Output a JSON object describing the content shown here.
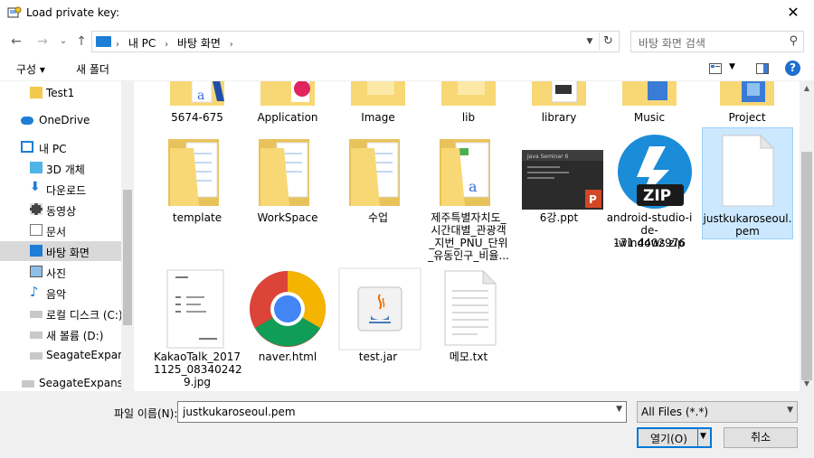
{
  "window": {
    "title": "Load private key:",
    "close_glyph": "✕"
  },
  "nav": {
    "back_glyph": "←",
    "forward_glyph": "→",
    "recent_glyph": "⌄",
    "up_glyph": "↑",
    "breadcrumb": [
      "내 PC",
      "바탕 화면"
    ],
    "crumb_separator": "›",
    "search_placeholder": "바탕 화면 검색"
  },
  "toolbar": {
    "organize_label": "구성 ▾",
    "new_folder_label": "새 폴더",
    "help_label": "?"
  },
  "sidebar": {
    "items": [
      {
        "label": "Test1",
        "icon": "folder-icon"
      },
      {
        "label": "OneDrive",
        "icon": "cloud-icon"
      },
      {
        "label": "내 PC",
        "icon": "computer-icon"
      },
      {
        "label": "3D 개체",
        "icon": "cube-icon"
      },
      {
        "label": "다운로드",
        "icon": "download-icon"
      },
      {
        "label": "동영상",
        "icon": "film-icon"
      },
      {
        "label": "문서",
        "icon": "document-icon"
      },
      {
        "label": "바탕 화면",
        "icon": "desktop-icon",
        "selected": true
      },
      {
        "label": "사진",
        "icon": "picture-icon"
      },
      {
        "label": "음악",
        "icon": "music-icon"
      },
      {
        "label": "로컬 디스크 (C:)",
        "icon": "drive-icon"
      },
      {
        "label": "새 볼륨 (D:)",
        "icon": "drive-icon"
      },
      {
        "label": "SeagateExpansic",
        "icon": "drive-icon"
      },
      {
        "label": "SeagateExpansion",
        "icon": "drive-icon"
      }
    ]
  },
  "files": {
    "row1": [
      "5674-675",
      "Application",
      "Image",
      "lib",
      "library",
      "Music",
      "Project"
    ],
    "row2": [
      {
        "name": "template",
        "lines": [
          "template"
        ]
      },
      {
        "name": "WorkSpace",
        "lines": [
          "WorkSpace"
        ]
      },
      {
        "name": "수업",
        "lines": [
          "수업"
        ]
      },
      {
        "name": "제주특별자치도_시간대별_관광객_지번_PNU_단위_유동인구_비율...",
        "lines": [
          "제주특별자치도_",
          "시간대별_관광객",
          "_지번_PNU_단위",
          "_유동인구_비율..."
        ]
      },
      {
        "name": "6강.ppt",
        "lines": [
          "6강.ppt"
        ]
      },
      {
        "name": "android-studio-ide-171.4402976-windows.zip",
        "lines": [
          "android-studio-i",
          "de-171.4402976",
          "-windows.zip"
        ]
      },
      {
        "name": "justkukaroseoul.pem",
        "lines": [
          "justkukaroseoul.",
          "pem"
        ],
        "selected": true
      }
    ],
    "row3": [
      {
        "name": "KakaoTalk_20171125_083402429.jpg",
        "lines": [
          "KakaoTalk_2017",
          "1125_08340242",
          "9.jpg"
        ]
      },
      {
        "name": "naver.html",
        "lines": [
          "naver.html"
        ]
      },
      {
        "name": "test.jar",
        "lines": [
          "test.jar"
        ]
      },
      {
        "name": "메모.txt",
        "lines": [
          "메모.txt"
        ]
      }
    ],
    "zip_badge": "ZIP",
    "ppt_header": "Java Seminar 6"
  },
  "footer": {
    "filename_label": "파일 이름(N):",
    "filename_value": "justkukaroseoul.pem",
    "filter_value": "All Files (*.*)",
    "open_label": "열기(O)",
    "cancel_label": "취소"
  },
  "colors": {
    "accent": "#0078d7",
    "selection_bg": "#cce8ff",
    "folder": "#f8d775"
  }
}
